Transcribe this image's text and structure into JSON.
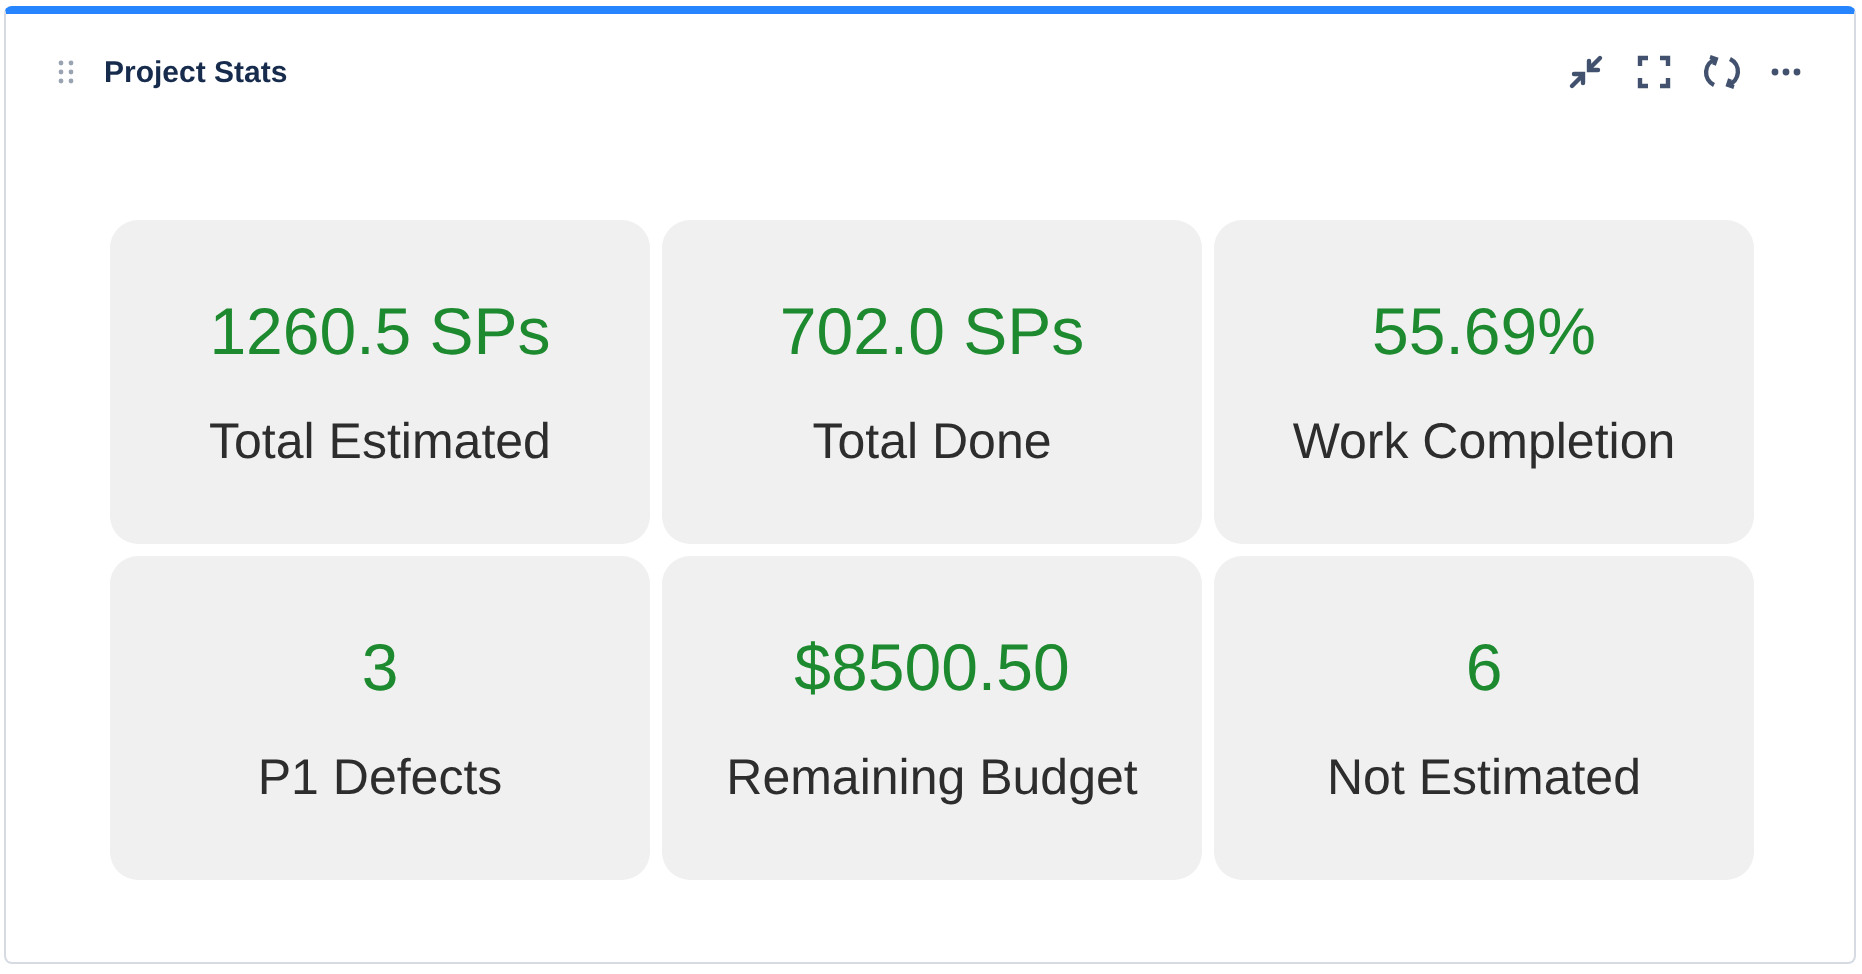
{
  "widget": {
    "title": "Project Stats"
  },
  "stats": [
    {
      "value": "1260.5 SPs",
      "label": "Total Estimated"
    },
    {
      "value": "702.0 SPs",
      "label": "Total Done"
    },
    {
      "value": "55.69%",
      "label": "Work Completion"
    },
    {
      "value": "3",
      "label": "P1 Defects"
    },
    {
      "value": "$8500.50",
      "label": "Remaining Budget"
    },
    {
      "value": "6",
      "label": "Not Estimated"
    }
  ]
}
